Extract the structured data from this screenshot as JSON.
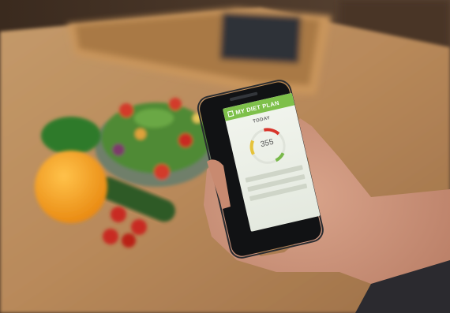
{
  "app": {
    "brand": "MY DIET PLAN",
    "section_label": "TODAY",
    "calorie_value": "355",
    "stat_rows": [
      "",
      "",
      ""
    ]
  },
  "colors": {
    "brand_green": "#7ec04a",
    "ring_red": "#d8352b",
    "ring_yellow": "#e6c33a",
    "ring_green": "#79b94a"
  },
  "icons": [
    "app-logo-icon"
  ]
}
